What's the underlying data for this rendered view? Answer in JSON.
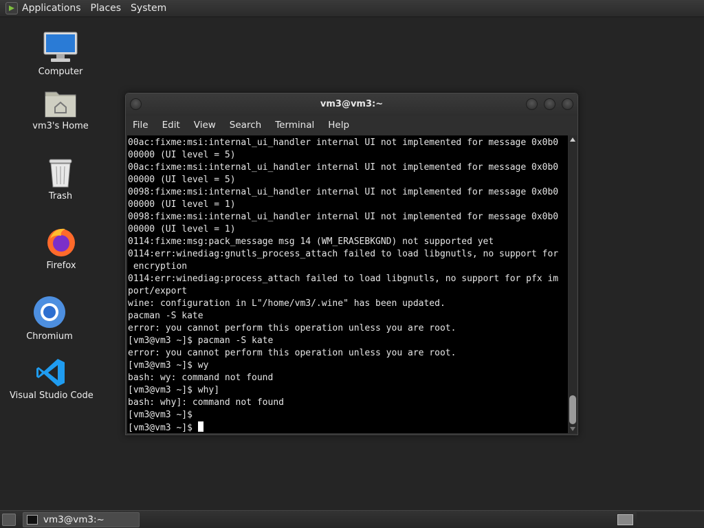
{
  "top_panel": {
    "menus": [
      "Applications",
      "Places",
      "System"
    ]
  },
  "desktop": {
    "icons": [
      {
        "label": "Computer",
        "icon": "computer-icon"
      },
      {
        "label": "vm3's Home",
        "icon": "home-folder-icon"
      },
      {
        "label": "Trash",
        "icon": "trash-icon"
      },
      {
        "label": "Firefox",
        "icon": "firefox-icon"
      },
      {
        "label": "Chromium",
        "icon": "chromium-icon"
      },
      {
        "label": "Visual Studio Code",
        "icon": "vscode-icon"
      }
    ]
  },
  "window": {
    "title": "vm3@vm3:~",
    "menu": [
      "File",
      "Edit",
      "View",
      "Search",
      "Terminal",
      "Help"
    ],
    "terminal_lines": [
      "00ac:fixme:msi:internal_ui_handler internal UI not implemented for message 0x0b0",
      "00000 (UI level = 5)",
      "00ac:fixme:msi:internal_ui_handler internal UI not implemented for message 0x0b0",
      "00000 (UI level = 5)",
      "0098:fixme:msi:internal_ui_handler internal UI not implemented for message 0x0b0",
      "00000 (UI level = 1)",
      "0098:fixme:msi:internal_ui_handler internal UI not implemented for message 0x0b0",
      "00000 (UI level = 1)",
      "0114:fixme:msg:pack_message msg 14 (WM_ERASEBKGND) not supported yet",
      "0114:err:winediag:gnutls_process_attach failed to load libgnutls, no support for",
      " encryption",
      "0114:err:winediag:process_attach failed to load libgnutls, no support for pfx im",
      "port/export",
      "wine: configuration in L\"/home/vm3/.wine\" has been updated.",
      "pacman -S kate",
      "error: you cannot perform this operation unless you are root.",
      "[vm3@vm3 ~]$ pacman -S kate",
      "error: you cannot perform this operation unless you are root.",
      "[vm3@vm3 ~]$ wy",
      "bash: wy: command not found",
      "[vm3@vm3 ~]$ why]",
      "bash: why]: command not found",
      "[vm3@vm3 ~]$"
    ],
    "prompt": "[vm3@vm3 ~]$ "
  },
  "taskbar": {
    "task_label": "vm3@vm3:~"
  }
}
